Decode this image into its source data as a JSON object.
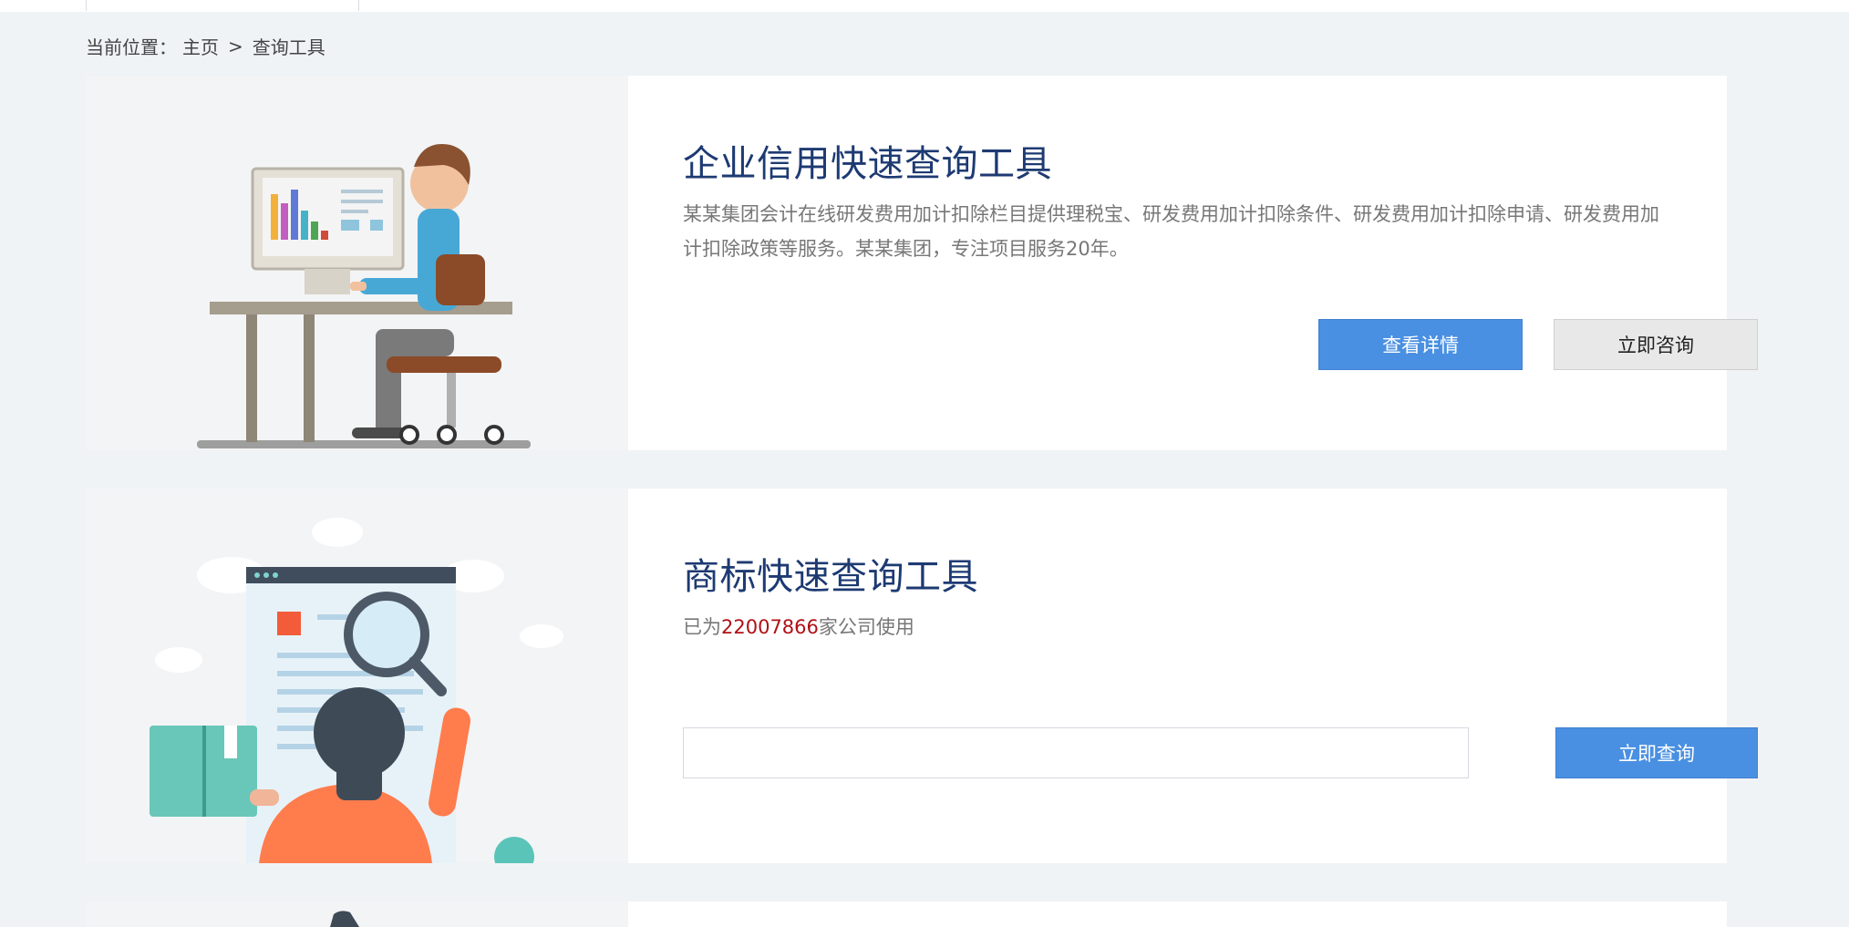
{
  "breadcrumb": {
    "label": "当前位置：",
    "home": "主页",
    "separator": ">",
    "current": "查询工具"
  },
  "cards": [
    {
      "title": "企业信用快速查询工具",
      "description": "某某集团会计在线研发费用加计扣除栏目提供理税宝、研发费用加计扣除条件、研发费用加计扣除申请、研发费用加计扣除政策等服务。某某集团，专注项目服务20年。",
      "primary_button": "查看详情",
      "secondary_button": "立即咨询"
    },
    {
      "title": "商标快速查询工具",
      "usage_prefix": "已为",
      "usage_count": "22007866",
      "usage_suffix": "家公司使用",
      "search_placeholder": "",
      "search_button": "立即查询"
    }
  ],
  "colors": {
    "page_bg": "#eff3f6",
    "title": "#1d3a72",
    "primary": "#4a90e2",
    "highlight": "#b01016"
  },
  "icons": [
    "office-worker-illustration",
    "trademark-search-illustration"
  ]
}
